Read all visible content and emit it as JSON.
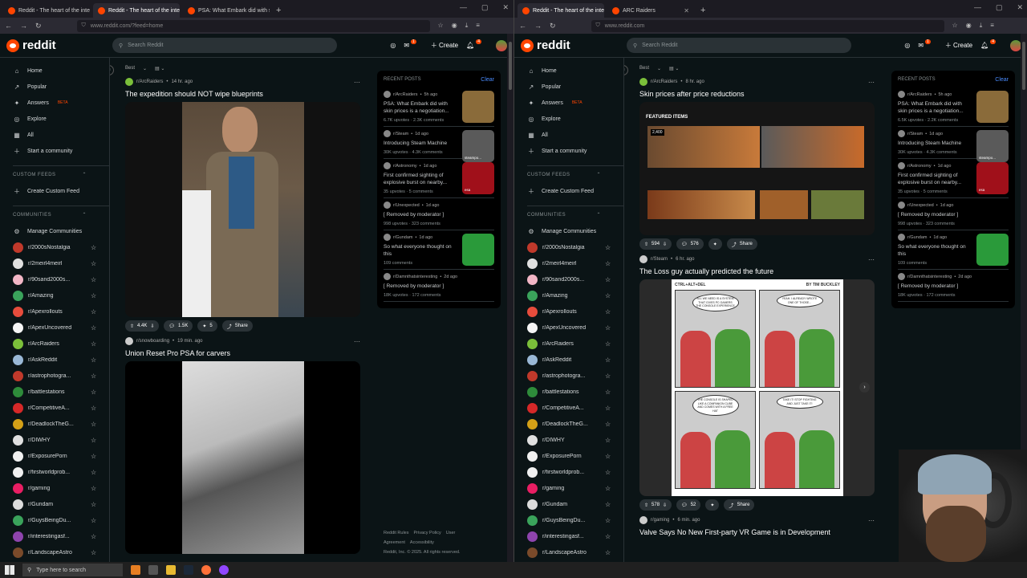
{
  "left": {
    "tabs": [
      {
        "label": "Reddit - The heart of the intern"
      },
      {
        "label": "Reddit - The heart of the intern"
      },
      {
        "label": "PSA: What Embark did with sk"
      }
    ],
    "active_tab": 1,
    "url": "www.reddit.com/?feed=home",
    "sort": "Best",
    "posts": [
      {
        "sub": "r/ArcRaiders",
        "time": "14 hr. ago",
        "title": "The expedition should NOT wipe blueprints",
        "up": "4.4K",
        "comments": "1.5K",
        "award": "5",
        "share": "Share"
      },
      {
        "sub": "r/snowboarding",
        "time": "19 min. ago",
        "title": "Union Reset Pro PSA for carvers"
      }
    ],
    "rail": [
      {
        "sub": "r/ArcRaiders",
        "time": "5h ago",
        "title": "PSA: What Embark did with skin prices is a negotiation...",
        "stats": "6.7K upvotes · 2.3K comments",
        "thumb": "#8a6b3a"
      },
      {
        "sub": "r/Steam",
        "time": "1d ago",
        "title": "Introducing Steam Machine",
        "stats": "30K upvotes · 4.3K comments",
        "thumb": "#5a5a5a",
        "thumb_label": "steampo..."
      },
      {
        "sub": "r/Astronomy",
        "time": "1d ago",
        "title": "First confirmed sighting of explosive burst on nearby...",
        "stats": "35 upvotes · 5 comments",
        "thumb": "#a0101a",
        "thumb_label": "esa"
      },
      {
        "sub": "r/Unexpected",
        "time": "1d ago",
        "title": "[ Removed by moderator ]",
        "stats": "998 upvotes · 323 comments"
      },
      {
        "sub": "r/Gundam",
        "time": "1d ago",
        "title": "So what everyone thought on this",
        "stats": "109 comments",
        "thumb": "#2a9a3a"
      },
      {
        "sub": "r/Damnthatsinteresting",
        "time": "2d ago",
        "title": "[ Removed by moderator ]",
        "stats": "18K upvotes · 172 comments"
      }
    ]
  },
  "right": {
    "tabs": [
      {
        "label": "Reddit - The heart of the intern"
      },
      {
        "label": "ARC Raiders"
      }
    ],
    "active_tab": 0,
    "url": "www.reddit.com",
    "sort": "Best",
    "posts": [
      {
        "sub": "r/ArcRaiders",
        "time": "8 hr. ago",
        "title": "Skin prices after price reductions",
        "up": "594",
        "comments": "576",
        "share": "Share",
        "store_header": "FEATURED ITEMS",
        "store_price": "2,400"
      },
      {
        "sub": "r/Steam",
        "time": "6 hr. ago",
        "title": "The Loss guy actually predicted the future",
        "up": "578",
        "comments": "52",
        "share": "Share",
        "comic_title": "CTRL+ALT+DEL",
        "comic_author": "BY TIM BUCKLEY",
        "panels": [
          "ALL WE NEED IS A SYSTEM THAT GIVES PC GAMERS THE CONSOLE EXPERIENCE",
          "YEAH. I ALREADY WROTE ONE OF THOSE...",
          "THE CONSOLE IS SHAPED LIKE A COMPANION CUBE AND COMES WITH A FREE HAT",
          "TAKE IT! STOP FIGHTING AND JUST TAKE IT!"
        ]
      },
      {
        "sub": "r/gaming",
        "time": "6 min. ago",
        "title": "Valve Says No New First-party VR Game is in Development"
      }
    ],
    "rail": [
      {
        "sub": "r/ArcRaiders",
        "time": "5h ago",
        "title": "PSA: What Embark did with skin prices is a negotiation...",
        "stats": "6.5K upvotes · 2.2K comments",
        "thumb": "#8a6b3a"
      },
      {
        "sub": "r/Steam",
        "time": "1d ago",
        "title": "Introducing Steam Machine",
        "stats": "30K upvotes · 4.3K comments",
        "thumb": "#5a5a5a",
        "thumb_label": "steampo..."
      },
      {
        "sub": "r/Astronomy",
        "time": "1d ago",
        "title": "First confirmed sighting of explosive burst on nearby...",
        "stats": "35 upvotes · 5 comments",
        "thumb": "#a0101a",
        "thumb_label": "esa"
      },
      {
        "sub": "r/Unexpected",
        "time": "1d ago",
        "title": "[ Removed by moderator ]",
        "stats": "998 upvotes · 323 comments"
      },
      {
        "sub": "r/Gundam",
        "time": "1d ago",
        "title": "So what everyone thought on this",
        "stats": "109 comments",
        "thumb": "#2a9a3a"
      },
      {
        "sub": "r/Damnthatsinteresting",
        "time": "2d ago",
        "title": "[ Removed by moderator ]",
        "stats": "18K upvotes · 172 comments"
      }
    ]
  },
  "header": {
    "search_placeholder": "Search Reddit",
    "create": "Create",
    "chat_badge": "1",
    "notif_badge": "4"
  },
  "nav": [
    "Home",
    "Popular",
    "Answers",
    "Explore",
    "All",
    "Start a community"
  ],
  "beta": "BETA",
  "custom_feeds": {
    "title": "CUSTOM FEEDS",
    "create": "Create Custom Feed"
  },
  "communities": {
    "title": "COMMUNITIES",
    "manage": "Manage Communities",
    "items": [
      {
        "name": "r/2000sNostalgia",
        "color": "#c0392b"
      },
      {
        "name": "r/2meirl4meirl",
        "color": "#e0e0e0"
      },
      {
        "name": "r/90sand2000s...",
        "color": "#f2b6c6"
      },
      {
        "name": "r/Amazing",
        "color": "#3aa35b"
      },
      {
        "name": "r/Apexrollouts",
        "color": "#e74c3c"
      },
      {
        "name": "r/ApexUncovered",
        "color": "#f5f5f5"
      },
      {
        "name": "r/ArcRaiders",
        "color": "#7bbf3a"
      },
      {
        "name": "r/AskReddit",
        "color": "#9ab8d6"
      },
      {
        "name": "r/astrophotogra...",
        "color": "#c0392b"
      },
      {
        "name": "r/battlestations",
        "color": "#2e8b3a"
      },
      {
        "name": "r/CompetitiveA...",
        "color": "#d62828"
      },
      {
        "name": "r/DeadlockTheG...",
        "color": "#d4a017"
      },
      {
        "name": "r/DIWHY",
        "color": "#e0e0e0"
      },
      {
        "name": "r/ExposurePorn",
        "color": "#f0f0f0"
      },
      {
        "name": "r/firstworldprob...",
        "color": "#f0f0f0"
      },
      {
        "name": "r/gaming",
        "color": "#e91e63"
      },
      {
        "name": "r/Gundam",
        "color": "#dcdcdc"
      },
      {
        "name": "r/GuysBeingDu...",
        "color": "#3aa35b"
      },
      {
        "name": "r/interestingasf...",
        "color": "#8e44ad"
      },
      {
        "name": "r/LandscapeAstro",
        "color": "#7a4a2a"
      }
    ]
  },
  "footer": {
    "links": [
      "Reddit Rules",
      "Privacy Policy",
      "User Agreement",
      "Accessibility"
    ],
    "copyright": "Reddit, Inc. © 2025. All rights reserved."
  },
  "taskbar": {
    "search": "Type here to search"
  }
}
